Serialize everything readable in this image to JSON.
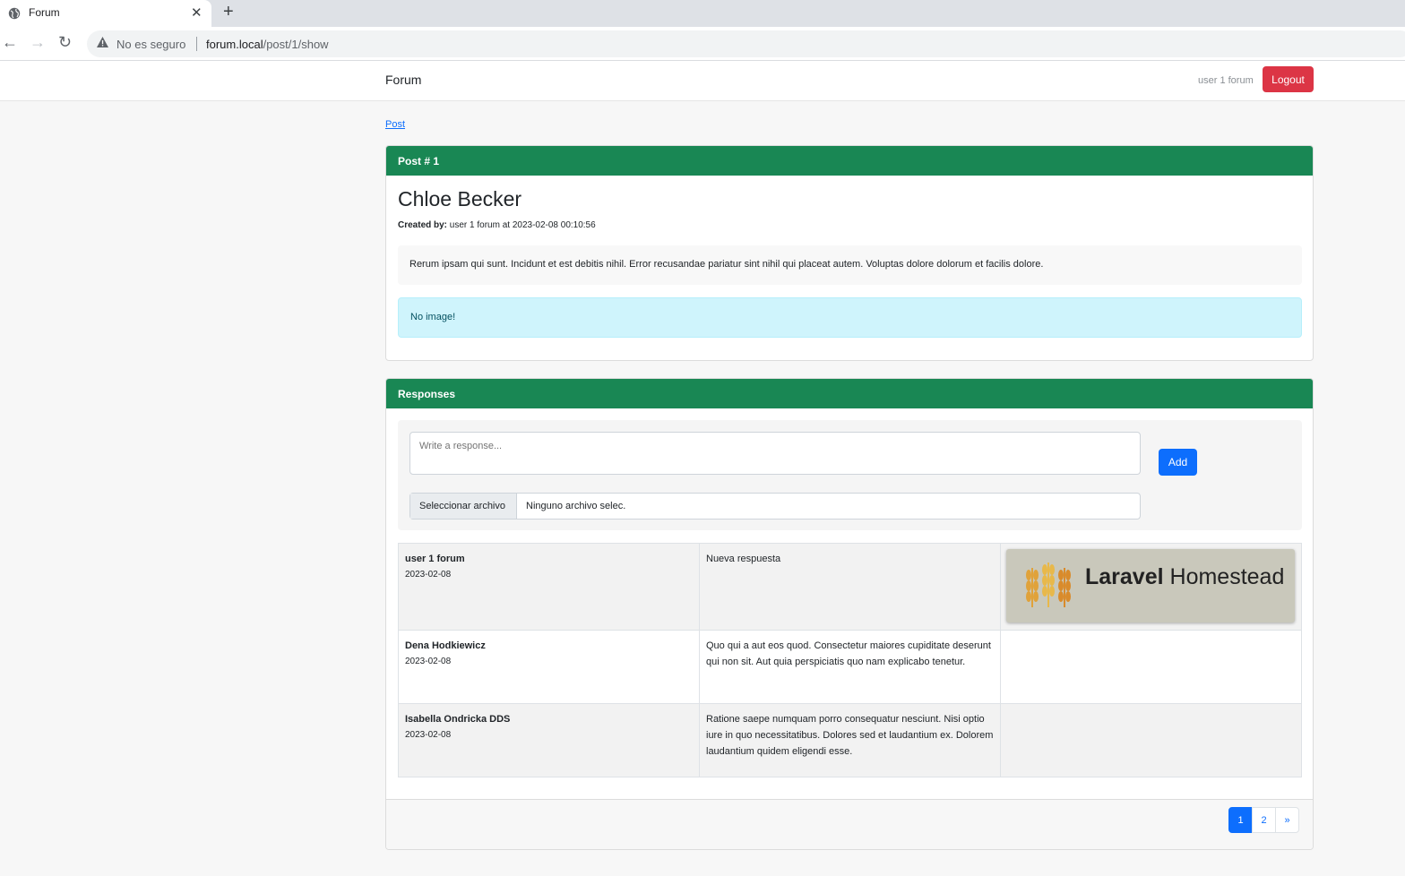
{
  "browser": {
    "tab_title": "Forum",
    "tab_close": "✕",
    "new_tab": "+",
    "back": "←",
    "forward": "→",
    "reload": "↻",
    "security_label": "No es seguro",
    "url_host": "forum.local",
    "url_path": "/post/1/show"
  },
  "navbar": {
    "brand": "Forum",
    "user": "user 1 forum",
    "logout_label": "Logout"
  },
  "breadcrumb": "Post",
  "post": {
    "header": "Post # 1",
    "title": "Chloe Becker",
    "created_by_label": "Created by:",
    "created_by_value": "user 1 forum at 2023-02-08 00:10:56",
    "body": "Rerum ipsam qui sunt. Incidunt et est debitis nihil. Error recusandae pariatur sint nihil qui placeat autem. Voluptas dolore dolorum et facilis dolore.",
    "image_notice": "No image!"
  },
  "responses": {
    "header": "Responses",
    "placeholder": "Write a response...",
    "add_label": "Add",
    "file_button": "Seleccionar archivo",
    "file_status": "Ninguno archivo selec.",
    "items": [
      {
        "author": "user 1 forum",
        "date": "2023-02-08",
        "text": "Nueva respuesta",
        "image_brand": "Laravel",
        "image_text": "Homestead"
      },
      {
        "author": "Dena Hodkiewicz",
        "date": "2023-02-08",
        "text": "Quo qui a aut eos quod. Consectetur maiores cupiditate deserunt qui non sit. Aut quia perspiciatis quo nam explicabo tenetur."
      },
      {
        "author": "Isabella Ondricka DDS",
        "date": "2023-02-08",
        "text": "Ratione saepe numquam porro consequatur nesciunt. Nisi optio iure in quo necessitatibus. Dolores sed et laudantium ex. Dolorem laudantium quidem eligendi esse."
      }
    ]
  },
  "pagination": {
    "pages": [
      "1",
      "2"
    ],
    "next": "»",
    "current": "1"
  },
  "colors": {
    "header_green": "#198754",
    "primary_blue": "#0d6efd",
    "danger_red": "#dc3545",
    "info_bg": "#cff4fc"
  }
}
